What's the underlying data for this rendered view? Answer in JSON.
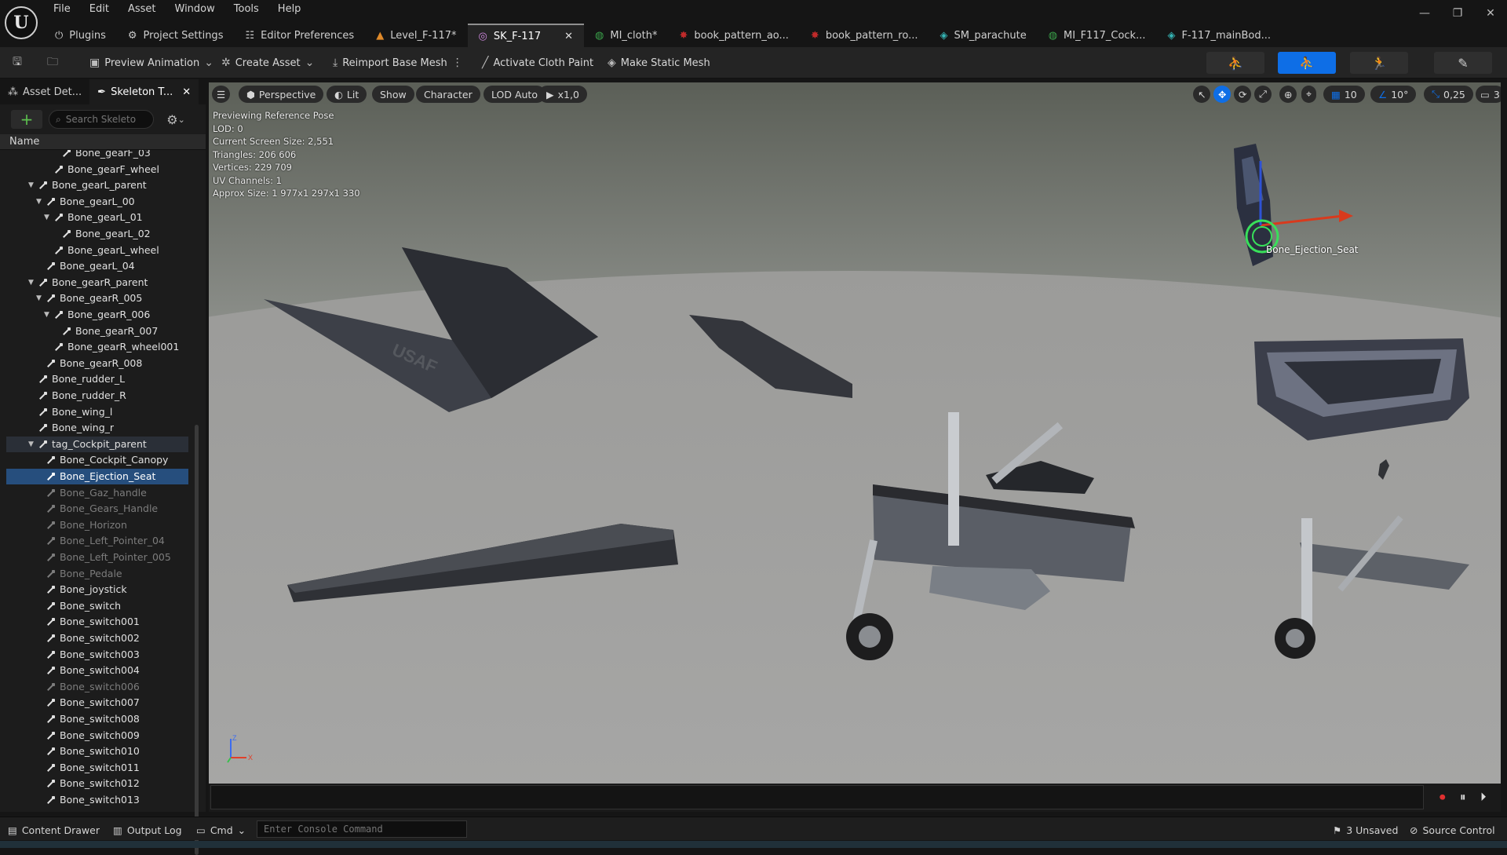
{
  "menu": [
    "File",
    "Edit",
    "Asset",
    "Window",
    "Tools",
    "Help"
  ],
  "tabs": [
    {
      "label": "Plugins",
      "icon": "plug-icon"
    },
    {
      "label": "Project Settings",
      "icon": "gear-icon"
    },
    {
      "label": "Editor Preferences",
      "icon": "sliders-icon"
    },
    {
      "label": "Level_F-117*",
      "icon": "level-icon"
    },
    {
      "label": "SK_F-117",
      "icon": "skeletal-mesh-icon",
      "active": true
    },
    {
      "label": "MI_cloth*",
      "icon": "material-instance-icon"
    },
    {
      "label": "book_pattern_ao...",
      "icon": "texture-icon"
    },
    {
      "label": "book_pattern_ro...",
      "icon": "texture-icon"
    },
    {
      "label": "SM_parachute",
      "icon": "static-mesh-icon"
    },
    {
      "label": "MI_F117_Cock...",
      "icon": "material-instance-icon"
    },
    {
      "label": "F-117_mainBod...",
      "icon": "static-mesh-icon"
    }
  ],
  "toolbar": {
    "preview_animation": "Preview Animation",
    "create_asset": "Create Asset",
    "reimport": "Reimport Base Mesh",
    "cloth_paint": "Activate Cloth Paint",
    "make_static": "Make Static Mesh"
  },
  "panel": {
    "tab1": "Asset Det...",
    "tab2": "Skeleton T...",
    "search_placeholder": "Search Skeleto",
    "column": "Name"
  },
  "tree": [
    {
      "label": "Bone_gearF_03",
      "depth": 4,
      "state": "normal"
    },
    {
      "label": "Bone_gearF_wheel",
      "depth": 3,
      "state": "normal"
    },
    {
      "label": "Bone_gearL_parent",
      "depth": 1,
      "state": "normal",
      "exp": true
    },
    {
      "label": "Bone_gearL_00",
      "depth": 2,
      "state": "normal",
      "exp": true
    },
    {
      "label": "Bone_gearL_01",
      "depth": 3,
      "state": "normal",
      "exp": true
    },
    {
      "label": "Bone_gearL_02",
      "depth": 4,
      "state": "normal"
    },
    {
      "label": "Bone_gearL_wheel",
      "depth": 3,
      "state": "normal"
    },
    {
      "label": "Bone_gearL_04",
      "depth": 2,
      "state": "normal"
    },
    {
      "label": "Bone_gearR_parent",
      "depth": 1,
      "state": "normal",
      "exp": true
    },
    {
      "label": "Bone_gearR_005",
      "depth": 2,
      "state": "normal",
      "exp": true
    },
    {
      "label": "Bone_gearR_006",
      "depth": 3,
      "state": "normal",
      "exp": true
    },
    {
      "label": "Bone_gearR_007",
      "depth": 4,
      "state": "normal"
    },
    {
      "label": "Bone_gearR_wheel001",
      "depth": 3,
      "state": "normal"
    },
    {
      "label": "Bone_gearR_008",
      "depth": 2,
      "state": "normal"
    },
    {
      "label": "Bone_rudder_L",
      "depth": 1,
      "state": "normal"
    },
    {
      "label": "Bone_rudder_R",
      "depth": 1,
      "state": "normal"
    },
    {
      "label": "Bone_wing_l",
      "depth": 1,
      "state": "normal"
    },
    {
      "label": "Bone_wing_r",
      "depth": 1,
      "state": "normal"
    },
    {
      "label": "tag_Cockpit_parent",
      "depth": 1,
      "state": "hl",
      "exp": true
    },
    {
      "label": "Bone_Cockpit_Canopy",
      "depth": 2,
      "state": "normal"
    },
    {
      "label": "Bone_Ejection_Seat",
      "depth": 2,
      "state": "sel"
    },
    {
      "label": "Bone_Gaz_handle",
      "depth": 2,
      "state": "dim"
    },
    {
      "label": "Bone_Gears_Handle",
      "depth": 2,
      "state": "dim"
    },
    {
      "label": "Bone_Horizon",
      "depth": 2,
      "state": "dim"
    },
    {
      "label": "Bone_Left_Pointer_04",
      "depth": 2,
      "state": "dim"
    },
    {
      "label": "Bone_Left_Pointer_005",
      "depth": 2,
      "state": "dim"
    },
    {
      "label": "Bone_Pedale",
      "depth": 2,
      "state": "dim"
    },
    {
      "label": "Bone_joystick",
      "depth": 2,
      "state": "normal"
    },
    {
      "label": "Bone_switch",
      "depth": 2,
      "state": "normal"
    },
    {
      "label": "Bone_switch001",
      "depth": 2,
      "state": "normal"
    },
    {
      "label": "Bone_switch002",
      "depth": 2,
      "state": "normal"
    },
    {
      "label": "Bone_switch003",
      "depth": 2,
      "state": "normal"
    },
    {
      "label": "Bone_switch004",
      "depth": 2,
      "state": "normal"
    },
    {
      "label": "Bone_switch006",
      "depth": 2,
      "state": "dim"
    },
    {
      "label": "Bone_switch007",
      "depth": 2,
      "state": "normal"
    },
    {
      "label": "Bone_switch008",
      "depth": 2,
      "state": "normal"
    },
    {
      "label": "Bone_switch009",
      "depth": 2,
      "state": "normal"
    },
    {
      "label": "Bone_switch010",
      "depth": 2,
      "state": "normal"
    },
    {
      "label": "Bone_switch011",
      "depth": 2,
      "state": "normal"
    },
    {
      "label": "Bone_switch012",
      "depth": 2,
      "state": "normal"
    },
    {
      "label": "Bone_switch013",
      "depth": 2,
      "state": "normal"
    }
  ],
  "viewport": {
    "perspective": "Perspective",
    "lit": "Lit",
    "show": "Show",
    "character": "Character",
    "lod": "LOD Auto",
    "speed": "x1,0",
    "grid_snap": "10",
    "rot_snap": "10°",
    "scale_snap": "0,25",
    "camera_speed": "3",
    "stats": [
      "Previewing Reference Pose",
      "LOD: 0",
      "Current Screen Size: 2,551",
      "Triangles: 206 606",
      "Vertices: 229 709",
      "UV Channels: 1",
      "Approx Size: 1 977x1 297x1 330"
    ],
    "selected_bone": "Bone_Ejection_Seat",
    "decal": "USAF"
  },
  "status": {
    "content_drawer": "Content Drawer",
    "output_log": "Output Log",
    "cmd": "Cmd",
    "console_placeholder": "Enter Console Command",
    "unsaved": "3 Unsaved",
    "source_control": "Source Control"
  },
  "colors": {
    "accent": "#0e6ee6",
    "selection": "#264e7d",
    "add": "#5cc04e"
  }
}
